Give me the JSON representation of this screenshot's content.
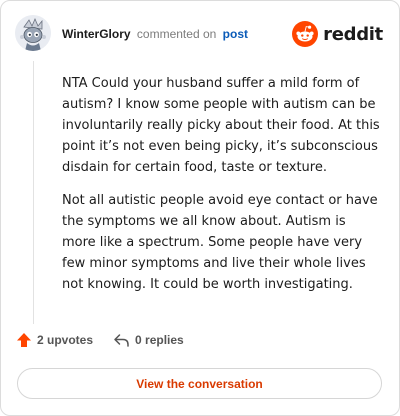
{
  "comment": {
    "username": "WinterGlory",
    "action": "commented on",
    "post_link": "post",
    "paragraphs": [
      "NTA Could your husband suffer a mild form of autism? I know some people with autism can be involuntarily really picky about their food. At this point it’s not even being picky, it’s subconscious disdain for certain food, taste or texture.",
      "Not all autistic people avoid eye contact or have the symptoms we all know about. Autism is more like a spectrum. Some people have very few minor symptoms and live their whole lives not knowing. It could be worth investigating."
    ]
  },
  "brand": {
    "name": "reddit",
    "icon": "reddit-logo-icon",
    "color": "#ff4500"
  },
  "footer": {
    "upvotes_label": "2 upvotes",
    "upvote_icon": "upvote-arrow-icon",
    "replies_label": "0 replies",
    "reply_icon": "reply-icon"
  },
  "cta": {
    "label": "View the conversation",
    "color": "#d93a00"
  }
}
